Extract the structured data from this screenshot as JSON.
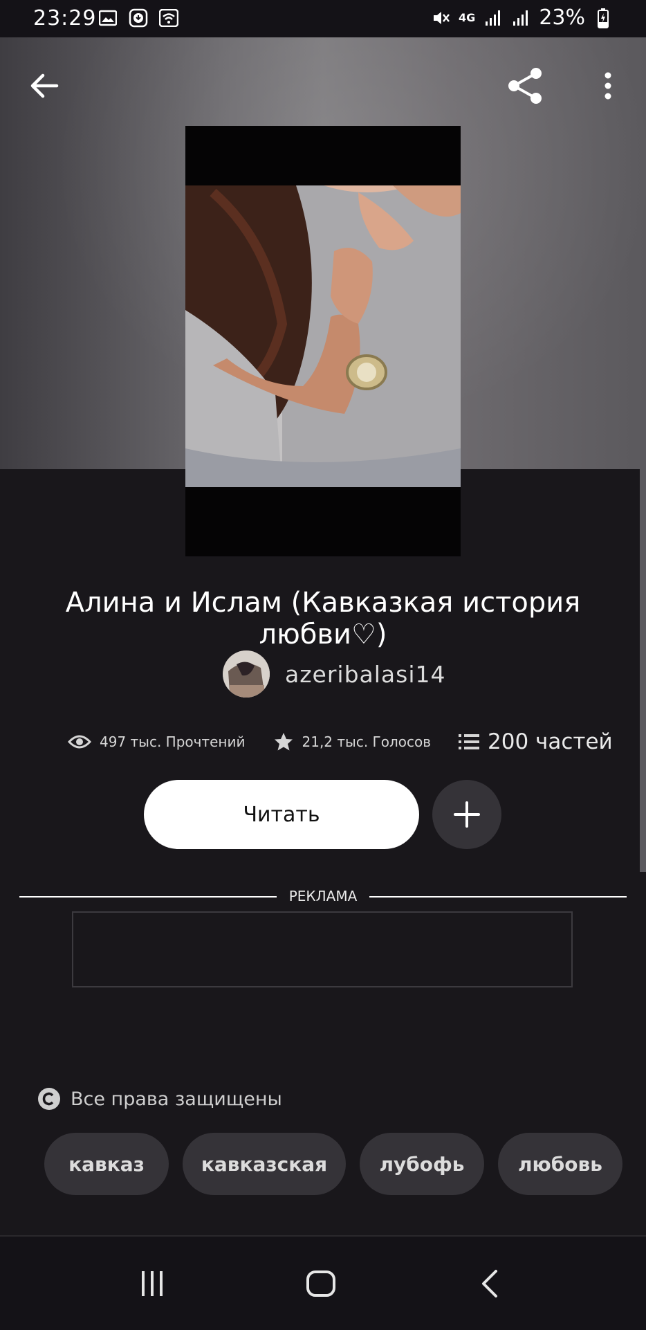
{
  "status_bar": {
    "time": "23:29",
    "network": "4G",
    "battery": "23%"
  },
  "book": {
    "title": "Алина и Ислам (Кавказкая история любви♡)",
    "author": "azeribalasi14",
    "reads": "497 тыс. Прочтений",
    "votes": "21,2 тыс. Голосов",
    "parts": "200 частей"
  },
  "actions": {
    "read_label": "Читать"
  },
  "ad": {
    "label": "РЕКЛАМА"
  },
  "copyright": {
    "text": "Все права защищены"
  },
  "tags": [
    "кавказ",
    "кавказская",
    "лубофь",
    "любовь"
  ],
  "icons": {
    "back": "arrow-left-icon",
    "share": "share-icon",
    "more": "more-vertical-icon",
    "views": "eye-icon",
    "votes": "star-icon",
    "parts": "list-icon",
    "add": "plus-icon",
    "copyright": "copyright-icon",
    "nav_recents": "recents-icon",
    "nav_home": "home-icon",
    "nav_back": "nav-back-icon"
  },
  "colors": {
    "background": "#19171b",
    "read_button": "#ffffff",
    "secondary_button": "#353338"
  }
}
